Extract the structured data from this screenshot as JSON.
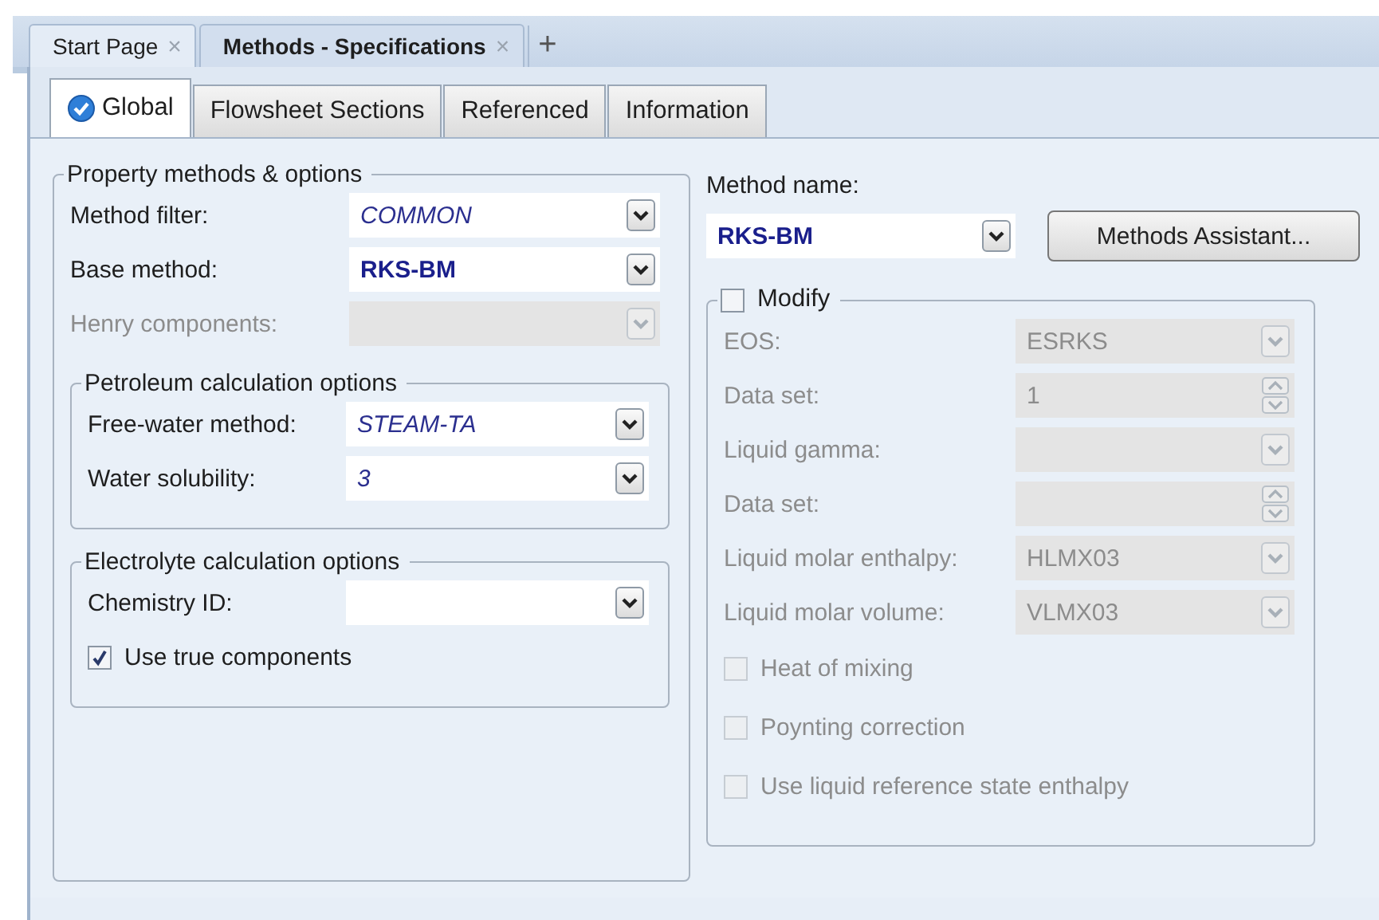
{
  "doc_tabs": [
    {
      "label": "Start Page",
      "close": "×",
      "selected": false
    },
    {
      "label": "Methods - Specifications",
      "close": "×",
      "selected": true
    }
  ],
  "new_tab": "+",
  "tabs": [
    {
      "label": "Global",
      "selected": true,
      "completed": true
    },
    {
      "label": "Flowsheet Sections",
      "selected": false,
      "completed": false
    },
    {
      "label": "Referenced",
      "selected": false,
      "completed": false
    },
    {
      "label": "Information",
      "selected": false,
      "completed": false
    }
  ],
  "property_methods": {
    "title": "Property methods & options",
    "fields": [
      {
        "label": "Method filter:",
        "value": "COMMON",
        "italic": true,
        "disabled": false
      },
      {
        "label": "Base method:",
        "value": "RKS-BM",
        "bold": true,
        "disabled": false
      },
      {
        "label": "Henry components:",
        "disabled": true
      }
    ]
  },
  "petroleum": {
    "title": "Petroleum calculation options",
    "fields": [
      {
        "label": "Free-water method:",
        "value": "STEAM-TA",
        "italic": true,
        "disabled": false
      },
      {
        "label": "Water solubility:",
        "value": "3",
        "italic": true,
        "disabled": false
      }
    ]
  },
  "electrolyte": {
    "title": "Electrolyte calculation options",
    "fields": [
      {
        "label": "Chemistry ID:",
        "disabled": false
      }
    ],
    "checkbox": {
      "label": "Use true components",
      "checked": true
    }
  },
  "method_name": {
    "label": "Method name:",
    "value": "RKS-BM",
    "bold": true
  },
  "assistant_button": "Methods Assistant...",
  "modify": {
    "label": "Modify",
    "checked": false,
    "fields": [
      {
        "label": "EOS:",
        "value": "ESRKS",
        "kind": "dropdown",
        "disabled": true
      },
      {
        "label": "Data set:",
        "value": "1",
        "kind": "spin",
        "disabled": true
      },
      {
        "label": "Liquid gamma:",
        "kind": "dropdown",
        "disabled": true
      },
      {
        "label": "Data set:",
        "kind": "spin",
        "disabled": true
      },
      {
        "label": "Liquid molar enthalpy:",
        "value": "HLMX03",
        "kind": "dropdown",
        "disabled": true
      },
      {
        "label": "Liquid molar volume:",
        "value": "VLMX03",
        "kind": "dropdown",
        "disabled": true
      }
    ],
    "options": [
      {
        "label": "Heat of mixing",
        "checked": false,
        "disabled": true
      },
      {
        "label": "Poynting correction",
        "checked": false,
        "disabled": true
      },
      {
        "label": "Use liquid reference state enthalpy",
        "checked": false,
        "disabled": true
      }
    ]
  }
}
